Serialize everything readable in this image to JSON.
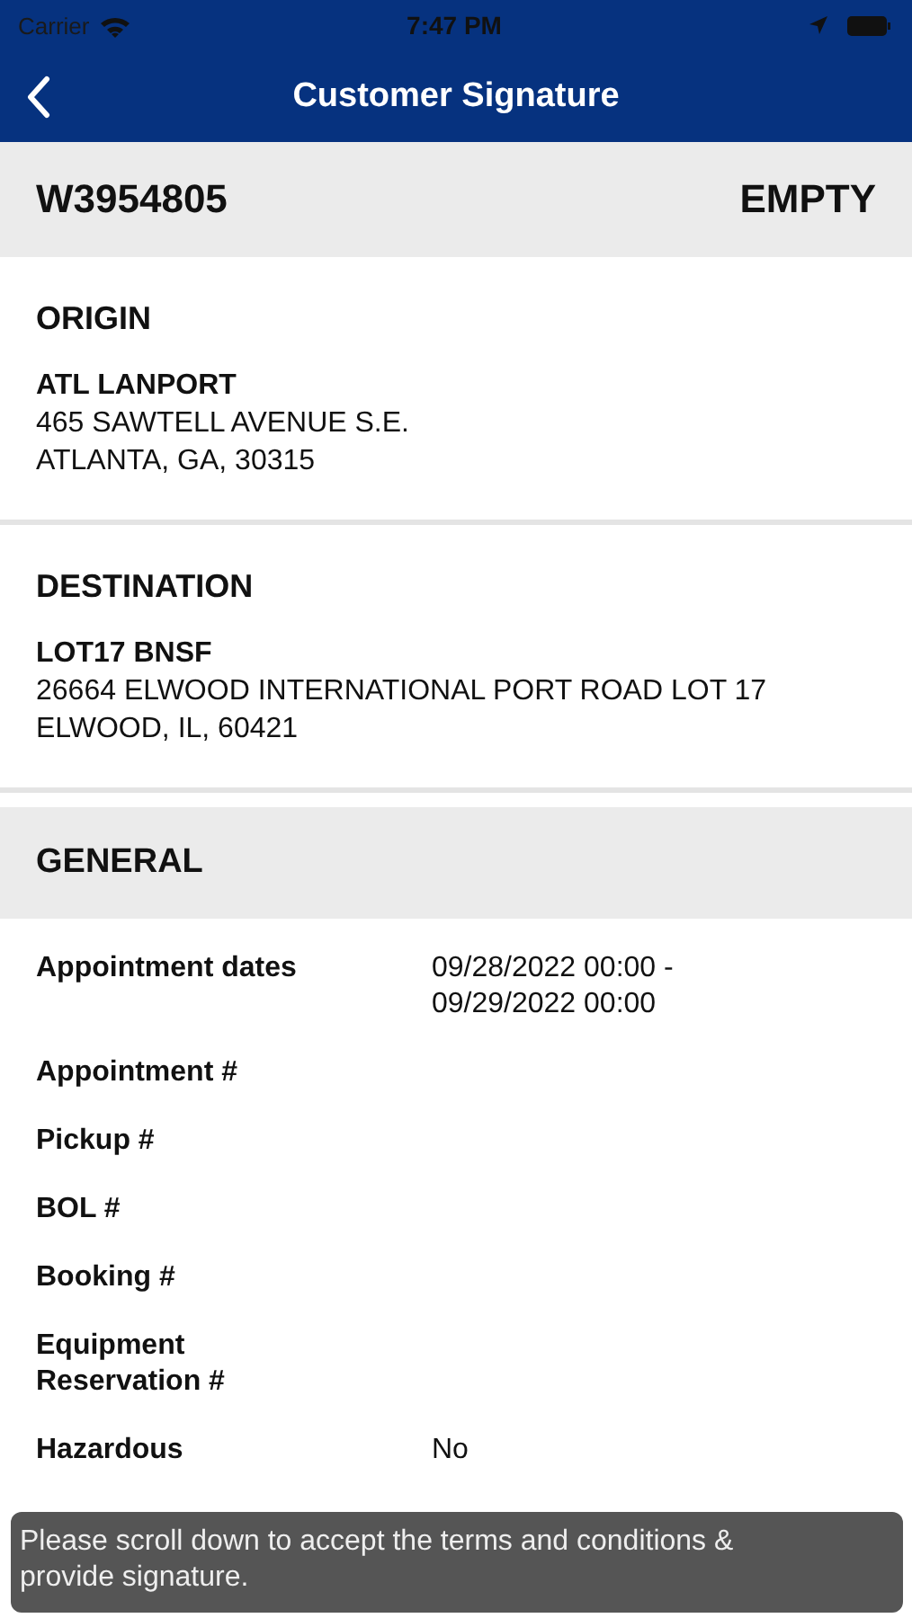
{
  "status_bar": {
    "carrier": "Carrier",
    "time": "7:47 PM"
  },
  "nav": {
    "title": "Customer Signature"
  },
  "header": {
    "id": "W3954805",
    "status": "EMPTY"
  },
  "sections": [
    {
      "title": "ORIGIN",
      "name": "ATL LANPORT",
      "lines": [
        "465 SAWTELL AVENUE S.E.",
        "ATLANTA, GA, 30315"
      ]
    },
    {
      "title": "DESTINATION",
      "name": "LOT17 BNSF",
      "lines": [
        "26664 ELWOOD INTERNATIONAL PORT ROAD LOT 17",
        "ELWOOD, IL, 60421"
      ]
    }
  ],
  "general": {
    "title": "GENERAL",
    "rows": [
      {
        "label": "Appointment dates",
        "value": "09/28/2022 00:00 -\n09/29/2022 00:00"
      },
      {
        "label": "Appointment #"
      },
      {
        "label": "Pickup #"
      },
      {
        "label": "BOL #"
      },
      {
        "label": "Booking #"
      },
      {
        "label": "Equipment\nReservation #"
      },
      {
        "label": "Hazardous",
        "value": "No"
      }
    ]
  },
  "toast": "Please scroll down to accept the terms and conditions & provide signature."
}
